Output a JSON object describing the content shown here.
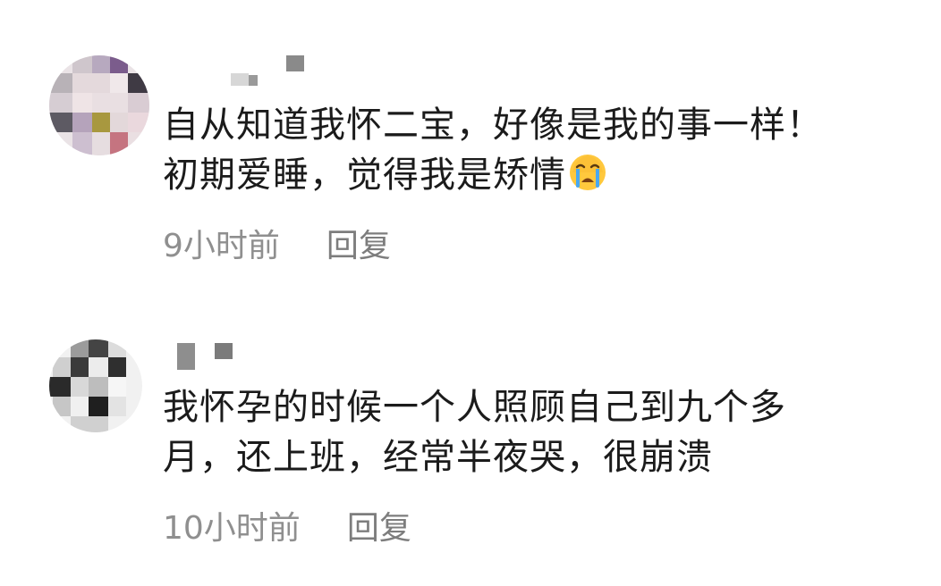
{
  "comments": [
    {
      "avatar": "avatar-mosaic-1",
      "lines": [
        "自从知道我怀二宝，好像是我的事一样！",
        "初期爱睡，觉得我是矫情"
      ],
      "emoji": "crying-face-icon",
      "time": "9小时前",
      "reply_label": "回复"
    },
    {
      "avatar": "avatar-mosaic-2",
      "lines": [
        "我怀孕的时候一个人照顾自己到九个多",
        "月，还上班，经常半夜哭，很崩溃"
      ],
      "time": "10小时前",
      "reply_label": "回复"
    }
  ],
  "colors": {
    "text": "#1b1b1b",
    "meta": "#8f8f8f",
    "background": "#ffffff"
  }
}
